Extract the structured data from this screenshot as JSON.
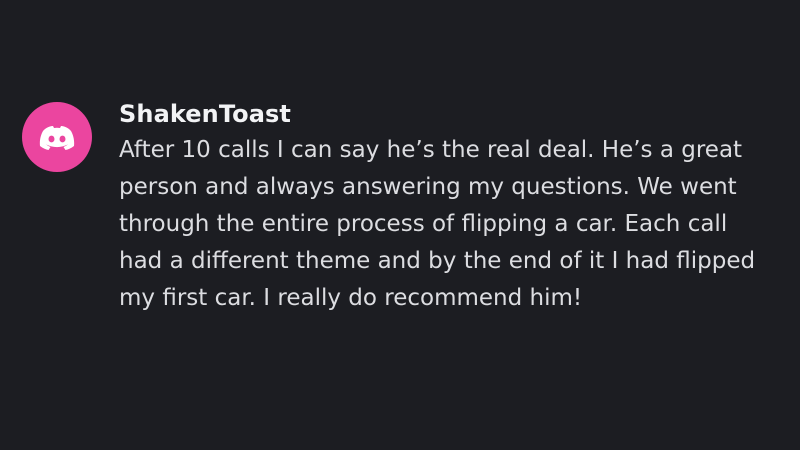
{
  "message": {
    "avatar_icon": "discord-logo-icon",
    "avatar_color": "#eb459f",
    "username": "ShakenToast",
    "text": "After 10 calls I can say he’s the real deal. He’s a great person and always answering my questions. We went through the entire process of flipping a car. Each call had a different theme and by the end of it I had flipped my first car. I really do recommend him!"
  },
  "colors": {
    "background": "#1c1d22",
    "username": "#f2f3f5",
    "message_text": "#dcdde1"
  }
}
